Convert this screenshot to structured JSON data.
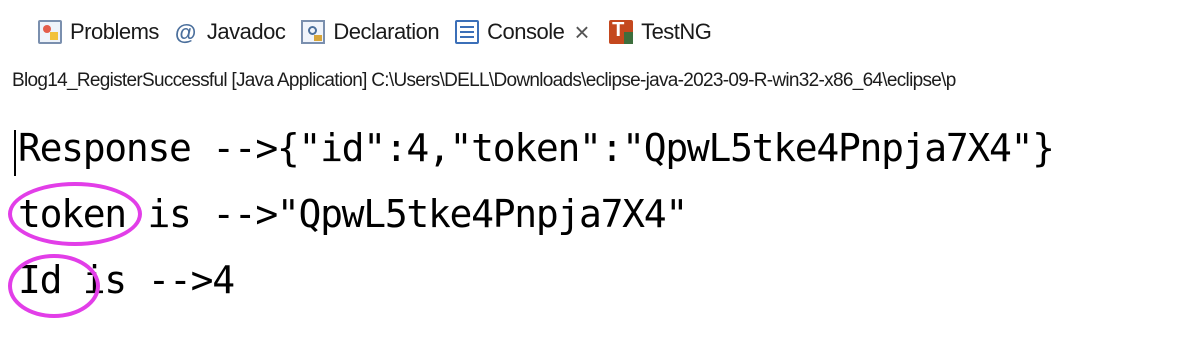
{
  "tabs": [
    {
      "label": "Problems",
      "icon": "problems-icon"
    },
    {
      "label": "Javadoc",
      "icon": "at-icon"
    },
    {
      "label": "Declaration",
      "icon": "declaration-icon"
    },
    {
      "label": "Console",
      "icon": "console-icon",
      "active": true
    },
    {
      "label": "TestNG",
      "icon": "testng-icon"
    }
  ],
  "console": {
    "launch_info": "Blog14_RegisterSuccessful [Java Application] C:\\Users\\DELL\\Downloads\\eclipse-java-2023-09-R-win32-x86_64\\eclipse\\p",
    "lines": [
      "Response -->{\"id\":4,\"token\":\"QpwL5tke4Pnpja7X4\"}",
      "token is -->\"QpwL5tke4Pnpja7X4\"",
      "Id is -->4"
    ]
  },
  "annotation_color": "#e23ee8"
}
